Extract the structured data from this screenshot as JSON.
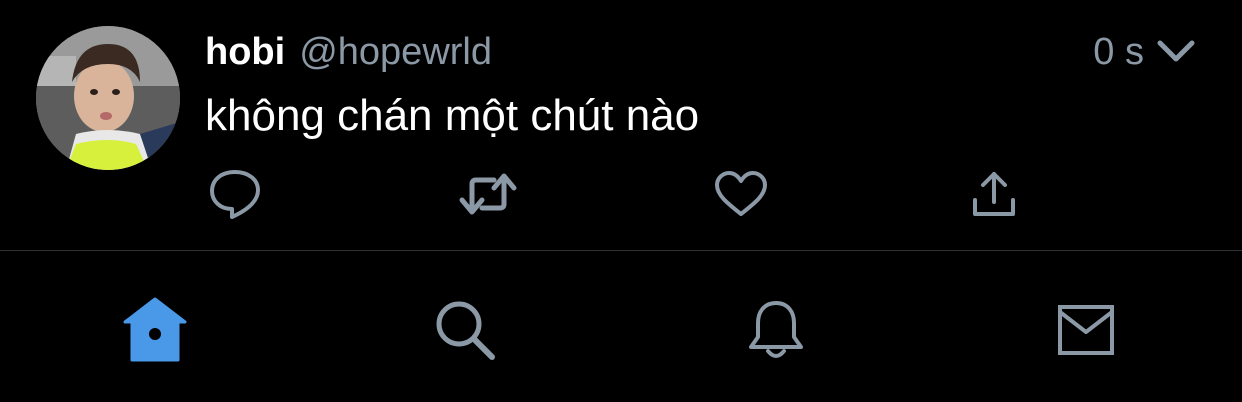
{
  "colors": {
    "background": "#000000",
    "primary_text": "#ffffff",
    "secondary_text": "#8b98a5",
    "divider": "#2f3336",
    "accent": "#4a99e9",
    "tab_inactive": "#8b98a5"
  },
  "tweet": {
    "display_name": "hobi",
    "handle": "@hopewrld",
    "timestamp": "0 s",
    "text": "không chán một chút nào",
    "actions": [
      {
        "name": "reply",
        "icon": "reply-bubble-icon"
      },
      {
        "name": "retweet",
        "icon": "retweet-icon"
      },
      {
        "name": "like",
        "icon": "heart-icon"
      },
      {
        "name": "share",
        "icon": "share-icon"
      }
    ]
  },
  "tabbar": {
    "tabs": [
      {
        "name": "home",
        "icon": "home-icon",
        "active": true
      },
      {
        "name": "search",
        "icon": "search-icon",
        "active": false
      },
      {
        "name": "notifications",
        "icon": "bell-icon",
        "active": false
      },
      {
        "name": "messages",
        "icon": "mail-icon",
        "active": false
      }
    ]
  }
}
